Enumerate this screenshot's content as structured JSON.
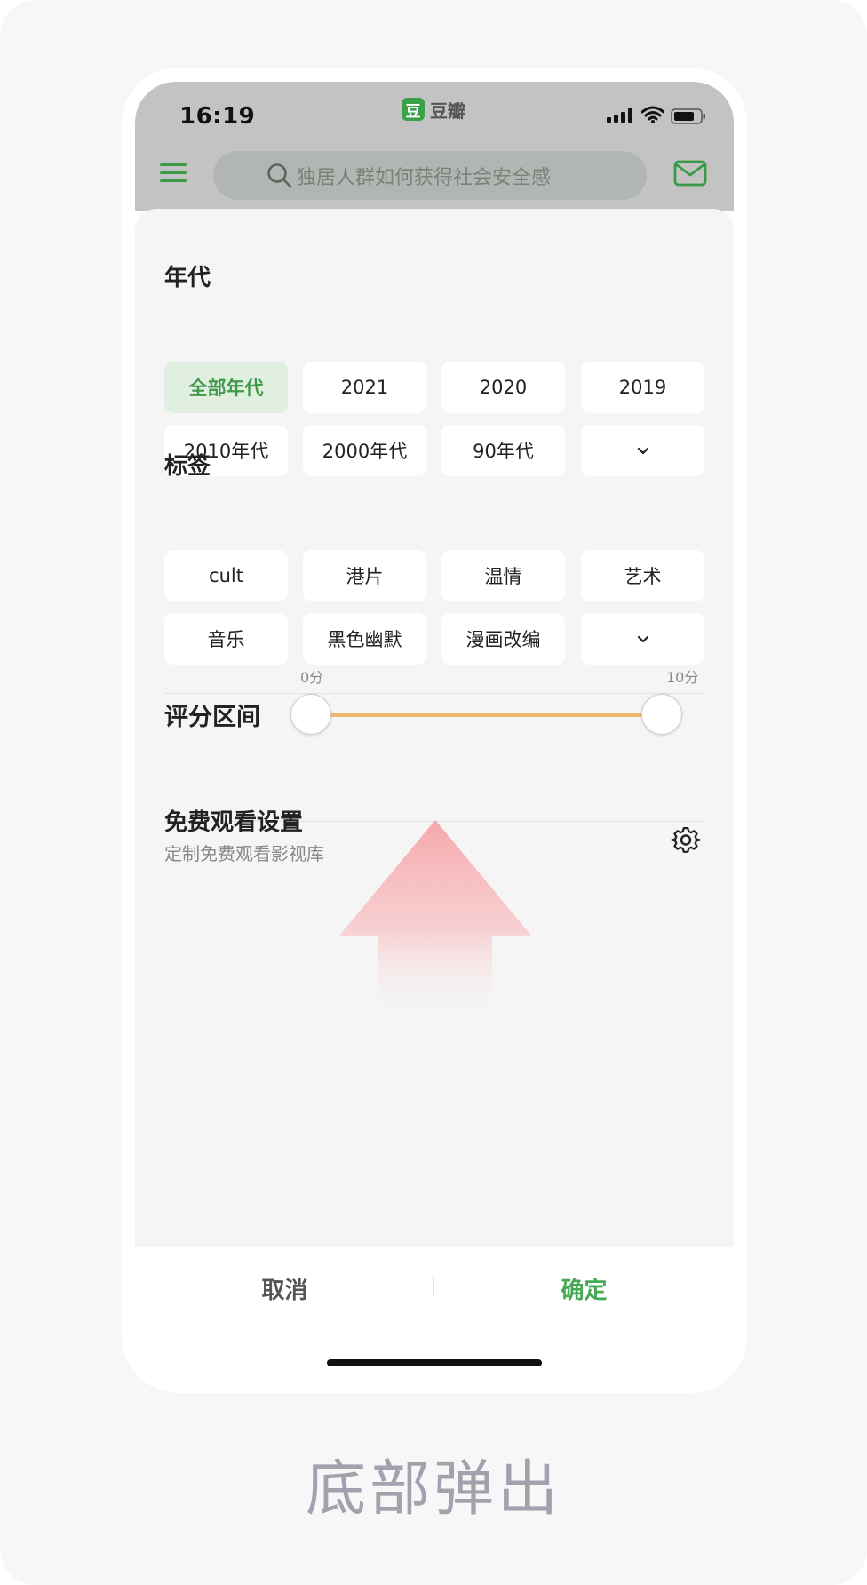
{
  "status_bar": {
    "time": "16:19",
    "app_logo_glyph": "豆",
    "app_name": "豆瓣"
  },
  "nav": {
    "search_placeholder": "独居人群如何获得社会安全感"
  },
  "year_section": {
    "title": "年代",
    "chips": [
      {
        "label": "全部年代",
        "selected": true
      },
      {
        "label": "2021",
        "selected": false
      },
      {
        "label": "2020",
        "selected": false
      },
      {
        "label": "2019",
        "selected": false
      },
      {
        "label": "2010年代",
        "selected": false
      },
      {
        "label": "2000年代",
        "selected": false
      },
      {
        "label": "90年代",
        "selected": false
      }
    ],
    "expand_icon": "chevron-down-icon"
  },
  "tag_section": {
    "title": "标签",
    "chips": [
      {
        "label": "cult"
      },
      {
        "label": "港片"
      },
      {
        "label": "温情"
      },
      {
        "label": "艺术"
      },
      {
        "label": "音乐"
      },
      {
        "label": "黑色幽默"
      },
      {
        "label": "漫画改编"
      }
    ],
    "expand_icon": "chevron-down-icon"
  },
  "rating": {
    "label": "评分区间",
    "min_label": "0分",
    "max_label": "10分",
    "range_min": 0,
    "range_max": 10,
    "selected_low": 0,
    "selected_high": 10
  },
  "free_watch": {
    "title": "免费观看设置",
    "subtitle": "定制免费观看影视库",
    "icon": "gear-icon"
  },
  "actions": {
    "cancel": "取消",
    "confirm": "确定"
  },
  "caption": "底部弹出",
  "colors": {
    "accent_green": "#3f9a4c",
    "slider_track": "#f0b96a",
    "selected_chip_bg": "#e1efe1"
  }
}
